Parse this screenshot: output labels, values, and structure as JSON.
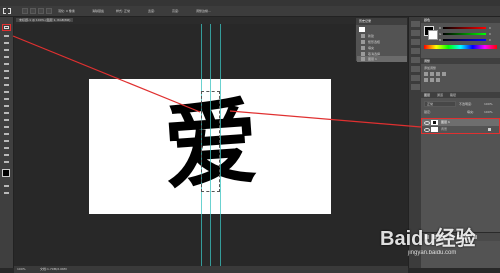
{
  "app": {
    "doc_tab": "未标题-1 @ 100% (图层 1, RGB/8#)",
    "status_zoom": "100%",
    "status_doc": "文档:1.79M/2.06M"
  },
  "options_bar": {
    "items": [
      "羽化: 0 像素",
      "消除锯齿",
      "样式: 正常",
      "宽度:",
      "高度:",
      "调整边缘..."
    ]
  },
  "history_panel": {
    "title": "历史记录",
    "items": [
      "新建",
      "矩形选框",
      "填充",
      "取消选择",
      "图层 1"
    ]
  },
  "color_panel": {
    "title": "颜色",
    "channels": [
      "R",
      "G",
      "B"
    ],
    "values": [
      "0",
      "0",
      "0"
    ]
  },
  "adjust_panel": {
    "title": "调整",
    "subtitle": "添加调整"
  },
  "layers_panel": {
    "tabs": [
      "图层",
      "通道",
      "路径"
    ],
    "blend_mode": "正常",
    "opacity_label": "不透明度:",
    "opacity": "100%",
    "lock_label": "锁定:",
    "fill_label": "填充:",
    "fill": "100%",
    "layers": [
      {
        "name": "图层 1",
        "visible": true,
        "selected": true
      },
      {
        "name": "背景",
        "visible": true,
        "selected": false
      }
    ]
  },
  "canvas": {
    "glyph": "爱"
  },
  "watermark": {
    "text": "Baidu经验",
    "sub": "jingyan.baidu.com"
  },
  "colors": {
    "accent_red": "#e03030",
    "guide_cyan": "#39c3c0",
    "panel_bg": "#535353",
    "workspace_bg": "#282828"
  }
}
